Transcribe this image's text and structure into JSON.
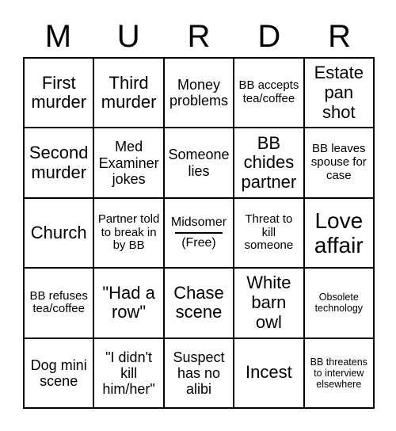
{
  "card": {
    "title_letters": [
      "M",
      "U",
      "R",
      "D",
      "R"
    ],
    "free_cell": {
      "top_label": "Midsomer",
      "bottom_label": "(Free)"
    },
    "rows": [
      [
        {
          "text": "First murder",
          "size": "lg"
        },
        {
          "text": "Third murder",
          "size": "lg"
        },
        {
          "text": "Money problems",
          "size": "md"
        },
        {
          "text": "BB accepts tea/coffee",
          "size": "sm"
        },
        {
          "text": "Estate pan shot",
          "size": "lg"
        }
      ],
      [
        {
          "text": "Second murder",
          "size": "lg"
        },
        {
          "text": "Med Examiner jokes",
          "size": "md"
        },
        {
          "text": "Someone lies",
          "size": "md"
        },
        {
          "text": "BB chides partner",
          "size": "lg"
        },
        {
          "text": "BB leaves spouse for case",
          "size": "sm"
        }
      ],
      [
        {
          "text": "Church",
          "size": "lg"
        },
        {
          "text": "Partner told to break in by BB",
          "size": "sm"
        },
        {
          "text": "",
          "size": "free"
        },
        {
          "text": "Threat to kill someone",
          "size": "sm"
        },
        {
          "text": "Love affair",
          "size": "xl"
        }
      ],
      [
        {
          "text": "BB refuses tea/coffee",
          "size": "sm"
        },
        {
          "text": "\"Had a row\"",
          "size": "lg"
        },
        {
          "text": "Chase scene",
          "size": "lg"
        },
        {
          "text": "White barn owl",
          "size": "lg"
        },
        {
          "text": "Obsolete technology",
          "size": "xs"
        }
      ],
      [
        {
          "text": "Dog mini scene",
          "size": "md"
        },
        {
          "text": "\"I didn't kill him/her\"",
          "size": "md"
        },
        {
          "text": "Suspect has no alibi",
          "size": "md"
        },
        {
          "text": "Incest",
          "size": "lg"
        },
        {
          "text": "BB threatens to interview elsewhere",
          "size": "xs"
        }
      ]
    ]
  },
  "colors": {
    "border": "#000000",
    "background": "#ffffff",
    "text": "#000000"
  }
}
